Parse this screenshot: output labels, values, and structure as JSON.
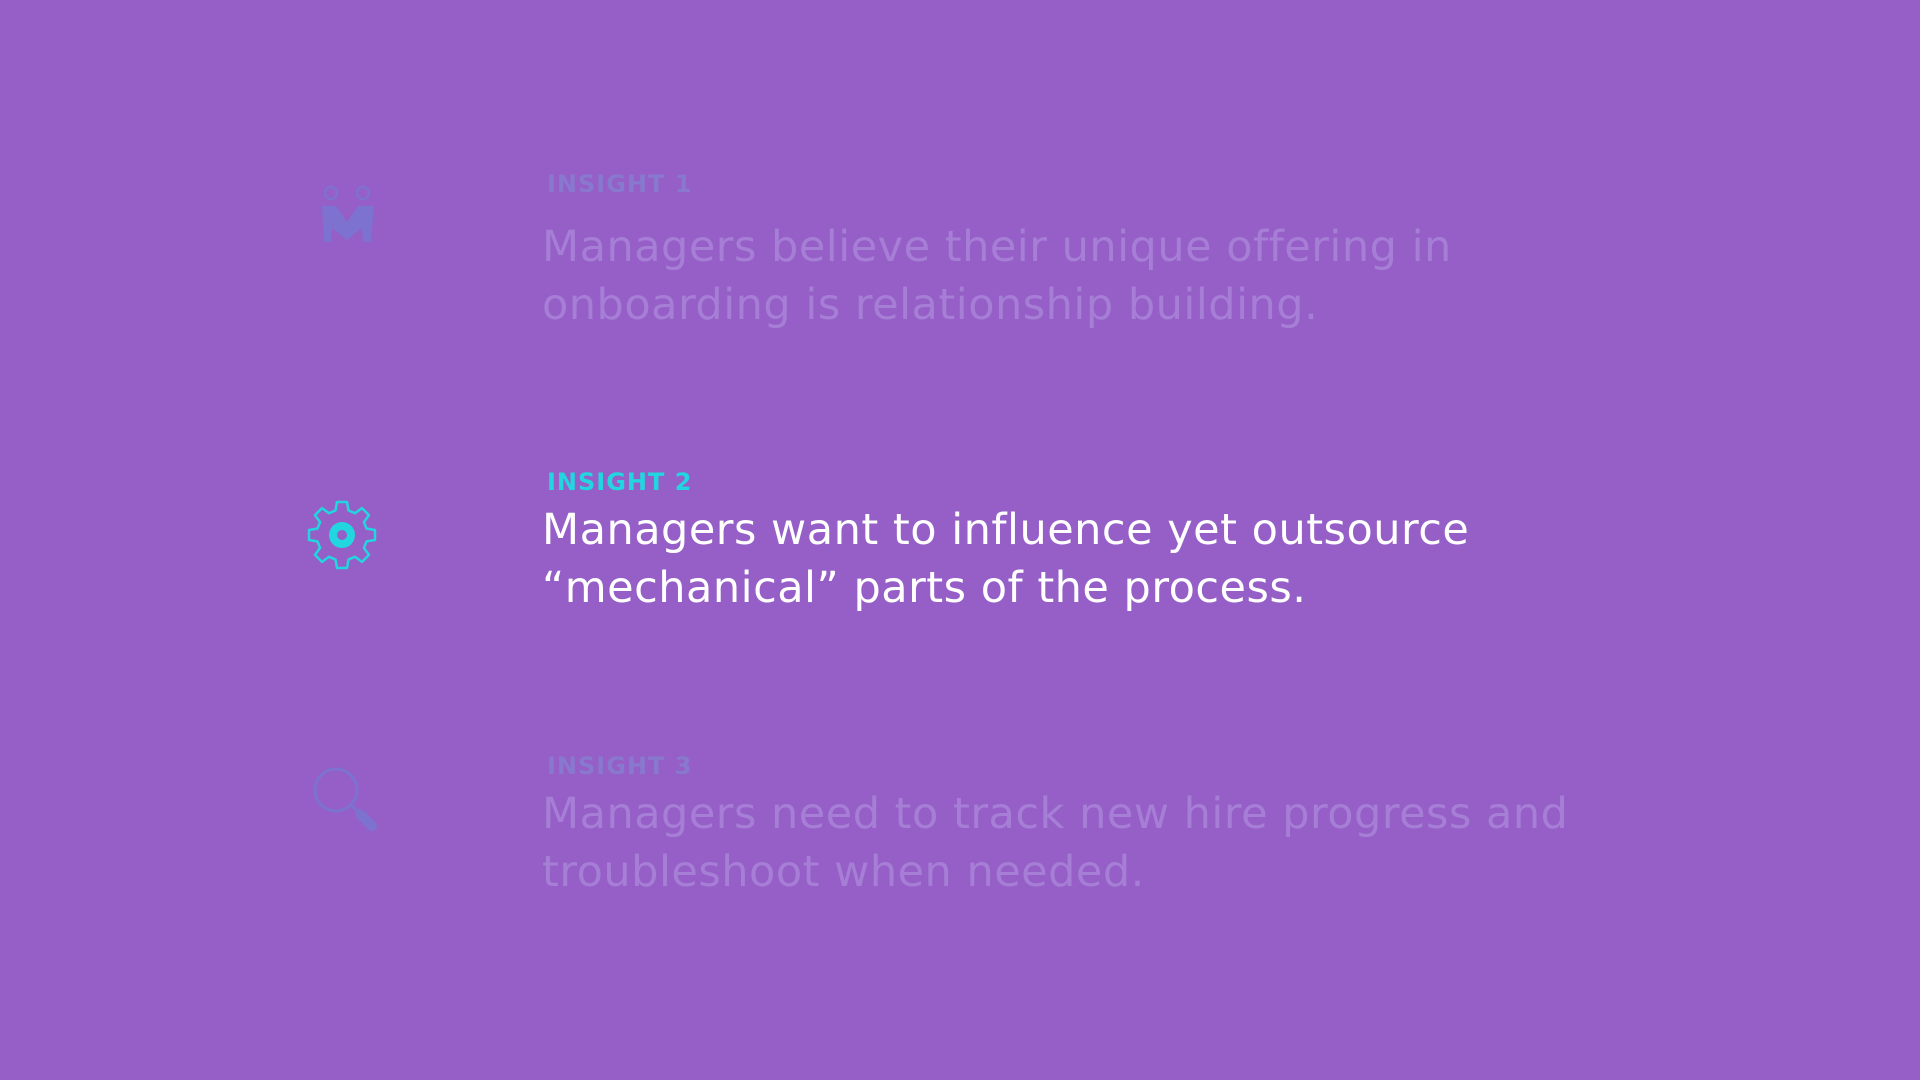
{
  "insights": [
    {
      "label": "INSIGHT 1",
      "line1": "Managers believe their unique offering in",
      "line2": "onboarding is relationship building.",
      "icon": "handshake-people-icon",
      "state": "dimmed"
    },
    {
      "label": "INSIGHT 2",
      "line1": "Managers want to influence yet outsource",
      "line2": "“mechanical” parts of the process.",
      "icon": "gear-icon",
      "state": "active"
    },
    {
      "label": "INSIGHT 3",
      "line1": "Managers need to track new hire progress and",
      "line2": "troubleshoot when needed.",
      "icon": "magnifier-icon",
      "state": "dimmed"
    }
  ],
  "colors": {
    "background": "#955fc7",
    "accent": "#22d6e0",
    "active_text": "#ffffff",
    "dim_label": "#8878ce",
    "dim_text": "#a67ed6",
    "dim_icon": "#7d72cf"
  }
}
